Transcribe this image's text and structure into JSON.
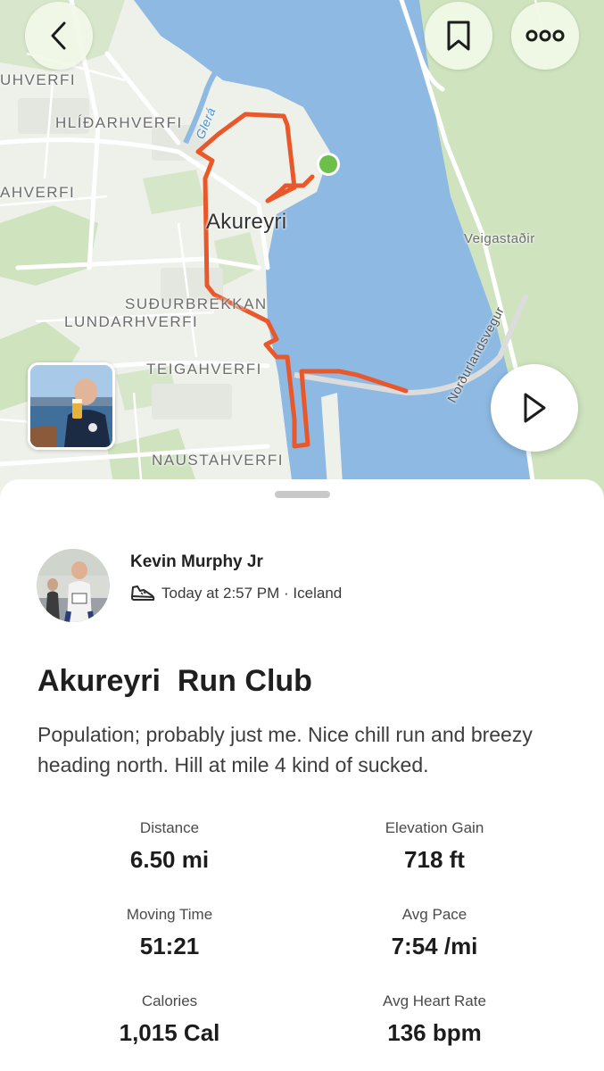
{
  "map": {
    "labels": {
      "uhverfi": "UHVERFI",
      "hlidarhverfi": "HLÍÐARHVERFI",
      "ahverfi": "AHVERFI",
      "glera": "Glerá",
      "akureyri": "Akureyri",
      "sudurbrekkan": "SUÐURBREKKAN",
      "lundarhverfi": "LUNDARHVERFI",
      "teigahverfi": "TEIGAHVERFI",
      "naustahverfi": "NAUSTAHVERFI",
      "veigastadir": "Veigastaðir",
      "nordurlandsvegur": "Norðurlandsvegur"
    },
    "colors": {
      "water": "#8db9e2",
      "land": "#eef0ea",
      "green": "#c8dfb6",
      "route": "#e8582a",
      "start_marker": "#6cc04a"
    },
    "icons": {
      "back": "chevron-left-icon",
      "bookmark": "bookmark-icon",
      "more": "more-dots-icon",
      "play": "play-icon"
    }
  },
  "activity": {
    "athlete_name": "Kevin Murphy Jr",
    "meta": "Today at 2:57 PM · Iceland",
    "sport_icon": "running-shoe-icon",
    "title": "Akureyri  Run Club",
    "description": "Population; probably just me. Nice chill run and breezy heading north. Hill at mile 4 kind of sucked.",
    "stats": [
      {
        "label": "Distance",
        "value": "6.50 mi"
      },
      {
        "label": "Elevation Gain",
        "value": "718 ft"
      },
      {
        "label": "Moving Time",
        "value": "51:21"
      },
      {
        "label": "Avg Pace",
        "value": "7:54 /mi"
      },
      {
        "label": "Calories",
        "value": "1,015 Cal"
      },
      {
        "label": "Avg Heart Rate",
        "value": "136 bpm"
      }
    ]
  }
}
